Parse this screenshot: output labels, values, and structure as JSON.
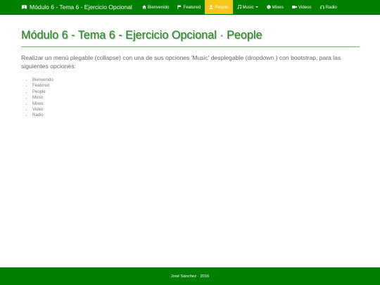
{
  "navbar": {
    "brand": "Módulo 6 - Tema 6 - Ejercicio Opcional",
    "brand_icon": "book-icon",
    "items": [
      {
        "label": "Bienvenido",
        "icon": "home-icon",
        "active": false
      },
      {
        "label": "Featured",
        "icon": "flag-icon",
        "active": false
      },
      {
        "label": "People",
        "icon": "user-icon",
        "active": true
      },
      {
        "label": "Music",
        "icon": "music-icon",
        "active": false,
        "dropdown": true
      },
      {
        "label": "Mixes",
        "icon": "globe-icon",
        "active": false
      },
      {
        "label": "Videos",
        "icon": "video-icon",
        "active": false
      },
      {
        "label": "Radio",
        "icon": "headphones-icon",
        "active": false
      }
    ]
  },
  "main": {
    "title": "Módulo 6 - Tema 6 - Ejercicio Opcional · People",
    "description": "Realizar un menú plegable (collapse) con una de sus opciones 'Music' desplegable (dropdown ) con bootstrap, para las siguientes opciones:",
    "options": [
      "Bienvenido",
      "Featured",
      "People",
      "Music",
      "Mixes",
      "Video",
      "Radio"
    ]
  },
  "footer": {
    "text": "José Sánchez · 2016"
  },
  "colors": {
    "navbar": "#008000",
    "active": "#f5c518",
    "title": "#1e8c1e",
    "footer": "#008000"
  }
}
